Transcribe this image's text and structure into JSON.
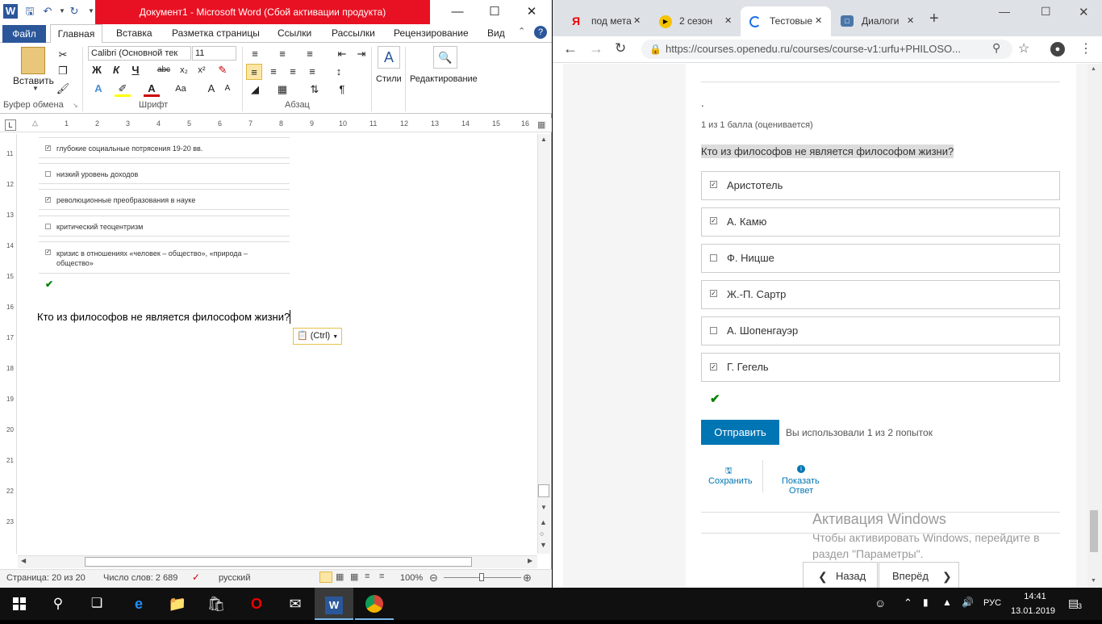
{
  "word": {
    "title": "Документ1  -  Microsoft Word (Сбой активации продукта)",
    "tabs": [
      "Файл",
      "Главная",
      "Вставка",
      "Разметка страницы",
      "Ссылки",
      "Рассылки",
      "Рецензирование",
      "Вид"
    ],
    "ribbon": {
      "paste_label": "Вставить",
      "group_clipboard": "Буфер обмена",
      "font_name": "Calibri (Основной тек",
      "font_size": "11",
      "group_font": "Шрифт",
      "group_paragraph": "Абзац",
      "styles_label": "Стили",
      "editing_label": "Редактирование",
      "bold": "Ж",
      "italic": "К",
      "underline": "Ч",
      "strike": "abc"
    },
    "ruler_numbers": [
      "1",
      "2",
      "3",
      "4",
      "5",
      "6",
      "7",
      "8",
      "9",
      "10",
      "11",
      "12",
      "13",
      "14",
      "15",
      "16"
    ],
    "vruler_numbers": [
      "11",
      "12",
      "13",
      "14",
      "15",
      "16",
      "17",
      "18",
      "19",
      "20",
      "21",
      "22",
      "23"
    ],
    "doc": {
      "options": [
        {
          "text": "глубокие социальные потрясения 19-20 вв.",
          "checked": true
        },
        {
          "text": "низкий уровень доходов",
          "checked": false
        },
        {
          "text": "революционные преобразования в науке",
          "checked": true
        },
        {
          "text": "критический теоцентризм",
          "checked": false
        },
        {
          "text": "кризис в отношениях «человек – общество», «природа – общество»",
          "checked": true
        }
      ],
      "question": "Кто из философов не является философом жизни?",
      "paste_tag": "(Ctrl)"
    },
    "status": {
      "page": "Страница: 20 из 20",
      "words": "Число слов: 2 689",
      "language": "русский",
      "zoom": "100%"
    }
  },
  "chrome": {
    "tabs": [
      "под мета",
      "2 сезон",
      "Тестовые",
      "Диалоги"
    ],
    "url": "https://courses.openedu.ru/courses/course-v1:urfu+PHILOSO...",
    "dot": ".",
    "score": "1 из 1 балла (оценивается)",
    "question": "Кто из философов не является философом жизни?",
    "answers": [
      {
        "text": "Аристотель",
        "checked": true
      },
      {
        "text": "А. Камю",
        "checked": true
      },
      {
        "text": "Ф. Ницше",
        "checked": false
      },
      {
        "text": "Ж.-П. Сартр",
        "checked": true
      },
      {
        "text": "А. Шопенгауэр",
        "checked": false
      },
      {
        "text": "Г. Гегель",
        "checked": true
      }
    ],
    "submit": "Отправить",
    "attempts": "Вы использовали 1 из 2 попыток",
    "save": "Сохранить",
    "show_answer_1": "Показать",
    "show_answer_2": "Ответ",
    "activation_title": "Активация Windows",
    "activation_text_1": "Чтобы активировать Windows, перейдите в",
    "activation_text_2": "раздел \"Параметры\".",
    "prev": "Назад",
    "next": "Вперёд"
  },
  "taskbar": {
    "lang": "РУС",
    "time": "14:41",
    "date": "13.01.2019",
    "notifications": "3"
  },
  "colors": {
    "word_blue": "#2b579a",
    "red": "#e81123",
    "edx_blue": "#0075b4",
    "check_green": "#008100"
  }
}
